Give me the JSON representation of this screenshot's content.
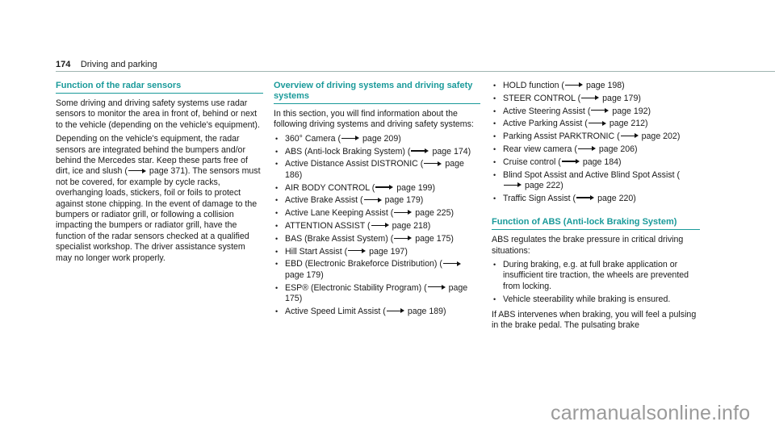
{
  "header": {
    "page_number": "174",
    "chapter": "Driving and parking"
  },
  "col1": {
    "heading": "Function of the radar sensors",
    "para1": "Some driving and driving safety systems use radar sensors to monitor the area in front of, behind or next to the vehicle (depending on the vehicle's equipment).",
    "para2_a": "Depending on the vehicle's equipment, the radar sensors are integrated behind the bumpers and/or behind the Mercedes star. Keep these parts free of dirt, ice and slush (",
    "para2_ref": "page 371",
    "para2_b": "). The sensors must not be covered, for example by cycle racks, overhanging loads, stickers, foil or foils to protect against stone chipping. In the event of damage to the bumpers or radiator grill, or following a collision impacting the bumpers or radiator grill, have the function of the radar sensors checked at a qualified specialist workshop. The driver assistance system may no longer work properly."
  },
  "col2": {
    "heading": "Overview of driving systems and driving safety systems",
    "intro": "In this section, you will find information about the following driving systems and driving safety systems:",
    "items": [
      {
        "label": "360° Camera",
        "page": "page 209"
      },
      {
        "label": "ABS (Anti-lock Braking System)",
        "page": "page 174"
      },
      {
        "label": "Active Distance Assist DISTRONIC",
        "page": "page 186"
      },
      {
        "label": "AIR BODY CONTROL",
        "page": "page 199"
      },
      {
        "label": "Active Brake Assist",
        "page": "page 179"
      },
      {
        "label": "Active Lane Keeping Assist",
        "page": "page 225"
      },
      {
        "label": "ATTENTION ASSIST",
        "page": "page 218"
      },
      {
        "label": "BAS (Brake Assist System)",
        "page": "page 175"
      },
      {
        "label": "Hill Start Assist",
        "page": "page 197"
      },
      {
        "label": "EBD (Electronic Brakeforce Distribution)",
        "page": "page 179"
      },
      {
        "label": "ESP® (Electronic Stability Program)",
        "page": "page 175"
      },
      {
        "label": "Active Speed Limit Assist",
        "page": "page 189"
      }
    ]
  },
  "col3": {
    "items": [
      {
        "label": "HOLD function",
        "page": "page 198"
      },
      {
        "label": "STEER CONTROL",
        "page": "page 179"
      },
      {
        "label": "Active Steering Assist",
        "page": "page 192"
      },
      {
        "label": "Active Parking Assist",
        "page": "page 212"
      },
      {
        "label": "Parking Assist PARKTRONIC",
        "page": "page 202"
      },
      {
        "label": "Rear view camera",
        "page": "page 206"
      },
      {
        "label": "Cruise control",
        "page": "page 184"
      },
      {
        "label": "Blind Spot Assist and Active Blind Spot Assist",
        "page": "page 222"
      },
      {
        "label": "Traffic Sign Assist",
        "page": "page 220"
      }
    ],
    "heading": "Function of ABS (Anti-lock Braking System)",
    "intro": "ABS regulates the brake pressure in critical driving situations:",
    "bullets": [
      "During braking, e.g. at full brake application or insufficient tire traction, the wheels are prevented from locking.",
      "Vehicle steerability while braking is ensured."
    ],
    "para": "If ABS intervenes when braking, you will feel a pulsing in the brake pedal. The pulsating brake"
  },
  "watermark": "carmanualsonline.info"
}
